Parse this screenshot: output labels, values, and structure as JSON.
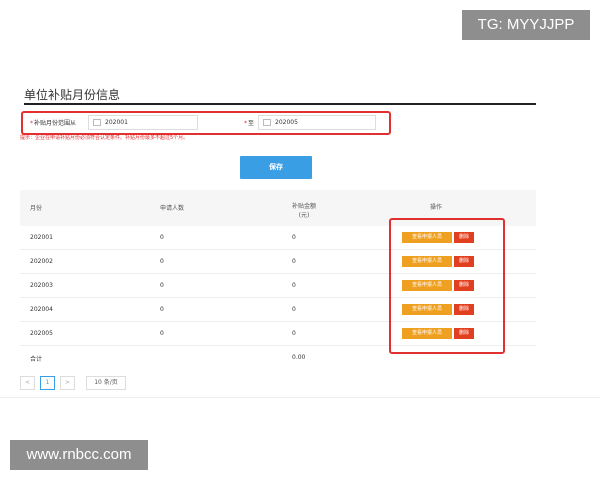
{
  "watermarks": {
    "top": "TG: MYYJJPP",
    "bottom": "www.rnbcc.com"
  },
  "panel": {
    "title": "单位补贴月份信息"
  },
  "form": {
    "required_mark": "*",
    "from_label": "补贴月份范围从",
    "from_value": "202001",
    "to_label": "至",
    "to_value": "202005",
    "tip": "提示：企业在申请补贴月份必须符合认定条件。补贴月份最多不超过5个月。"
  },
  "save_label": "保存",
  "table": {
    "headers": {
      "month": "月份",
      "count": "申请人数",
      "amount": "补贴金额\n(元)",
      "ops": "操作"
    },
    "rows": [
      {
        "month": "202001",
        "count": "0",
        "amount": "0"
      },
      {
        "month": "202002",
        "count": "0",
        "amount": "0"
      },
      {
        "month": "202003",
        "count": "0",
        "amount": "0"
      },
      {
        "month": "202004",
        "count": "0",
        "amount": "0"
      },
      {
        "month": "202005",
        "count": "0",
        "amount": "0"
      }
    ],
    "view_label": "查看申报人员",
    "delete_label": "删除",
    "total_label": "合计",
    "total_amount": "0.00"
  },
  "pager": {
    "prev": "<",
    "page": "1",
    "next": ">",
    "size": "10 条/页"
  },
  "colors": {
    "accent": "#3a9ee4",
    "highlight": "#e03030",
    "view_btn": "#f0a020",
    "delete_btn": "#e04020"
  }
}
